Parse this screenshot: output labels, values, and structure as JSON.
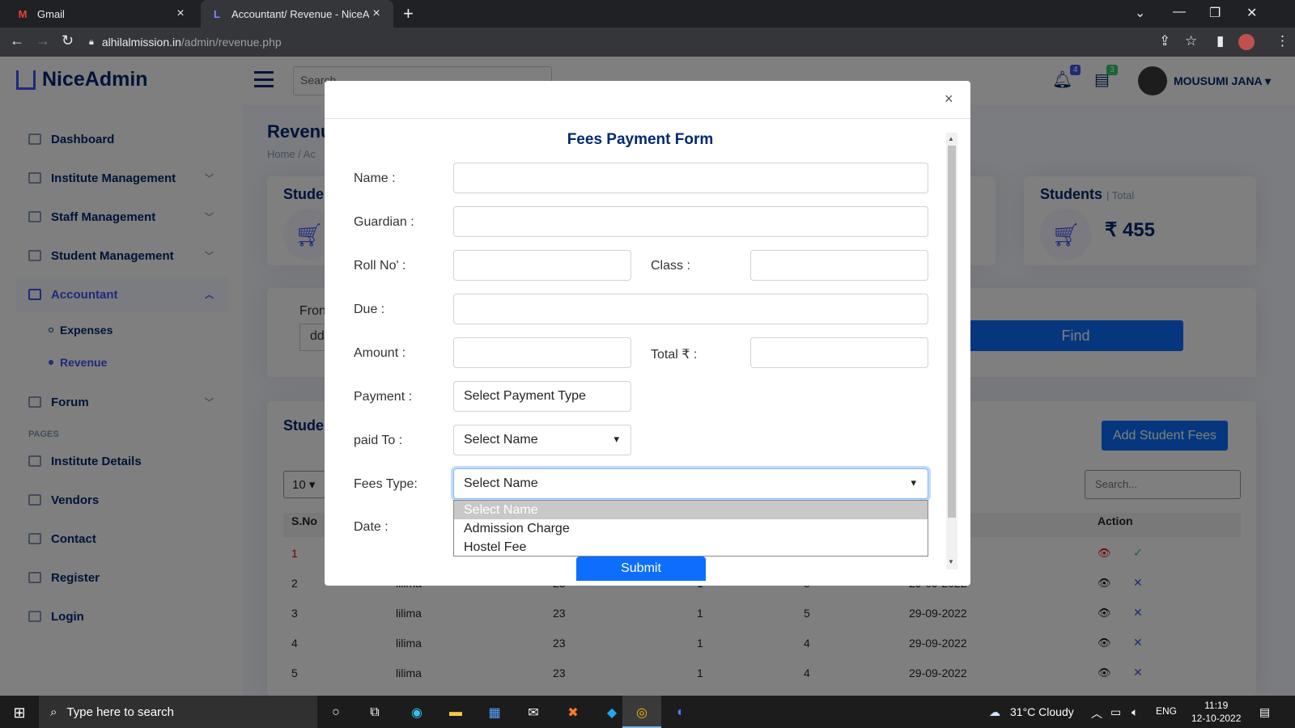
{
  "browser": {
    "tabs": [
      {
        "label": "Gmail"
      },
      {
        "label": "Accountant/ Revenue - NiceAdm"
      }
    ],
    "url_domain": "alhilalmission.in",
    "url_path": "/admin/revenue.php"
  },
  "header": {
    "brand": "NiceAdmin",
    "search_placeholder": "Search",
    "notif_count": "4",
    "msg_count": "3",
    "user_name": "MOUSUMI JANA"
  },
  "sidebar": {
    "items": [
      {
        "label": "Dashboard"
      },
      {
        "label": "Institute Management"
      },
      {
        "label": "Staff Management"
      },
      {
        "label": "Student Management"
      },
      {
        "label": "Accountant"
      },
      {
        "label": "Forum"
      }
    ],
    "subitems": [
      {
        "label": "Expenses"
      },
      {
        "label": "Revenue"
      }
    ],
    "pages_heading": "PAGES",
    "pages": [
      {
        "label": "Institute Details"
      },
      {
        "label": "Vendors"
      },
      {
        "label": "Contact"
      },
      {
        "label": "Register"
      },
      {
        "label": "Login"
      }
    ]
  },
  "main": {
    "title": "Revenu",
    "breadcrumb": "Home  /  Ac",
    "card1_title": "Stude",
    "card2_title": "Students",
    "card2_subtitle": "| Total",
    "card2_value": "₹ 455",
    "from_label": "Fron",
    "from_value": "dd",
    "find_label": "Find",
    "table_card_title": "Stude",
    "add_fees_label": "Add Student Fees",
    "entries_value": "10",
    "search_placeholder": "Search...",
    "col_sno": "S.No",
    "col_action": "Action",
    "rows": [
      {
        "sno": "1",
        "name": "",
        "a": "",
        "b": "",
        "c": "",
        "date": ""
      },
      {
        "sno": "2",
        "name": "lilima",
        "a": "23",
        "b": "1",
        "c": "5",
        "date": "29-09-2022"
      },
      {
        "sno": "3",
        "name": "lilima",
        "a": "23",
        "b": "1",
        "c": "5",
        "date": "29-09-2022"
      },
      {
        "sno": "4",
        "name": "lilima",
        "a": "23",
        "b": "1",
        "c": "4",
        "date": "29-09-2022"
      },
      {
        "sno": "5",
        "name": "lilima",
        "a": "23",
        "b": "1",
        "c": "4",
        "date": "29-09-2022"
      }
    ]
  },
  "modal": {
    "close": "×",
    "title": "Fees Payment Form",
    "labels": {
      "name": "Name :",
      "guardian": "Guardian :",
      "roll": "Roll No' :",
      "class": "Class :",
      "due": "Due :",
      "amount": "Amount :",
      "total": "Total ₹ :",
      "payment": "Payment :",
      "paid_to": "paid To :",
      "fees_type": "Fees Type:",
      "date": "Date :"
    },
    "payment_value": "Select Payment Type",
    "paid_to_value": "Select Name",
    "fees_type_value": "Select Name",
    "fees_type_options": [
      "Select Name",
      "Admission Charge",
      "Hostel Fee"
    ],
    "submit_label": "Submit"
  },
  "taskbar": {
    "search_placeholder": "Type here to search",
    "weather": "31°C  Cloudy",
    "lang": "ENG",
    "time": "11:19",
    "date": "12-10-2022"
  },
  "colors": {
    "primary": "#4154f1",
    "button_blue": "#0d6efd",
    "brand_navy": "#012970"
  }
}
